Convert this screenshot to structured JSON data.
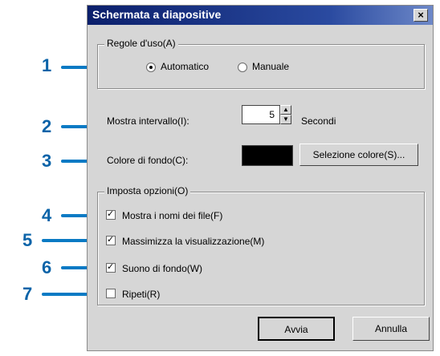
{
  "window": {
    "title": "Schermata a diapositive",
    "close_glyph": "×"
  },
  "usage_group": {
    "label": "Regole d'uso(A)",
    "options": [
      {
        "label": "Automatico",
        "selected": true
      },
      {
        "label": "Manuale",
        "selected": false
      }
    ]
  },
  "interval": {
    "label": "Mostra intervallo(I):",
    "value": "5",
    "unit": "Secondi"
  },
  "background": {
    "label": "Colore di fondo(C):",
    "swatch_color": "#000000",
    "select_button": "Selezione colore(S)..."
  },
  "options_group": {
    "label": "Imposta opzioni(O)",
    "items": [
      {
        "label": "Mostra i nomi dei file(F)",
        "checked": true
      },
      {
        "label": "Massimizza la visualizzazione(M)",
        "checked": true
      },
      {
        "label": "Suono di fondo(W)",
        "checked": true
      },
      {
        "label": "Ripeti(R)",
        "checked": false
      }
    ]
  },
  "buttons": {
    "ok": "Avvia",
    "cancel": "Annulla"
  },
  "callouts": [
    "1",
    "2",
    "3",
    "4",
    "5",
    "6",
    "7"
  ]
}
